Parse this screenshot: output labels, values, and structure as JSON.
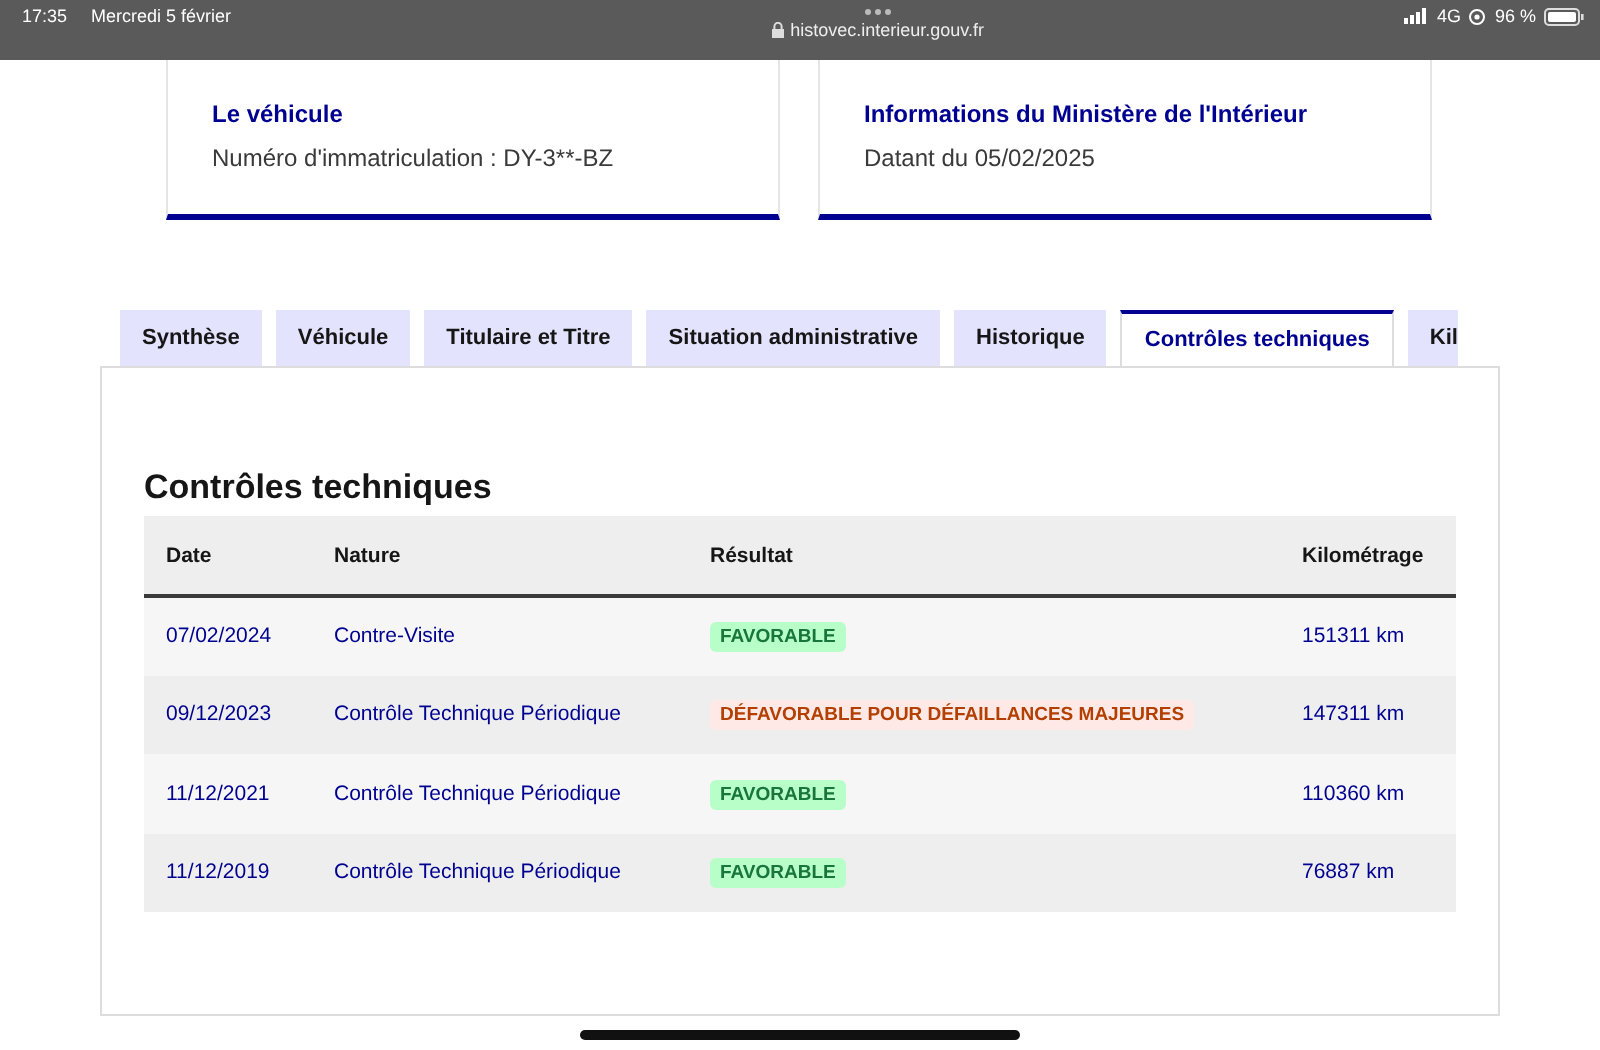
{
  "status_bar": {
    "time": "17:35",
    "date": "Mercredi 5 février",
    "url": "histovec.interieur.gouv.fr",
    "network": "4G",
    "battery": "96 %"
  },
  "cards": [
    {
      "title": "Le véhicule",
      "text": "Numéro d'immatriculation : DY-3**-BZ"
    },
    {
      "title": "Informations du Ministère de l'Intérieur",
      "text": "Datant du 05/02/2025"
    }
  ],
  "tabs": [
    {
      "label": "Synthèse",
      "selected": false
    },
    {
      "label": "Véhicule",
      "selected": false
    },
    {
      "label": "Titulaire et Titre",
      "selected": false
    },
    {
      "label": "Situation administrative",
      "selected": false
    },
    {
      "label": "Historique",
      "selected": false
    },
    {
      "label": "Contrôles techniques",
      "selected": true
    },
    {
      "label": "Kil",
      "selected": false
    }
  ],
  "section_title": "Contrôles techniques",
  "table": {
    "columns": [
      "Date",
      "Nature",
      "Résultat",
      "Kilométrage"
    ],
    "rows": [
      {
        "date": "07/02/2024",
        "nature": "Contre-Visite",
        "result": {
          "kind": "favorable",
          "label": "FAVORABLE"
        },
        "mileage": "151311 km"
      },
      {
        "date": "09/12/2023",
        "nature": "Contrôle Technique Périodique",
        "result": {
          "kind": "unfavorable",
          "label": "DÉFAVORABLE POUR DÉFAILLANCES MAJEURES"
        },
        "mileage": "147311 km"
      },
      {
        "date": "11/12/2021",
        "nature": "Contrôle Technique Périodique",
        "result": {
          "kind": "favorable",
          "label": "FAVORABLE"
        },
        "mileage": "110360 km"
      },
      {
        "date": "11/12/2019",
        "nature": "Contrôle Technique Périodique",
        "result": {
          "kind": "favorable",
          "label": "FAVORABLE"
        },
        "mileage": "76887 km"
      }
    ]
  }
}
